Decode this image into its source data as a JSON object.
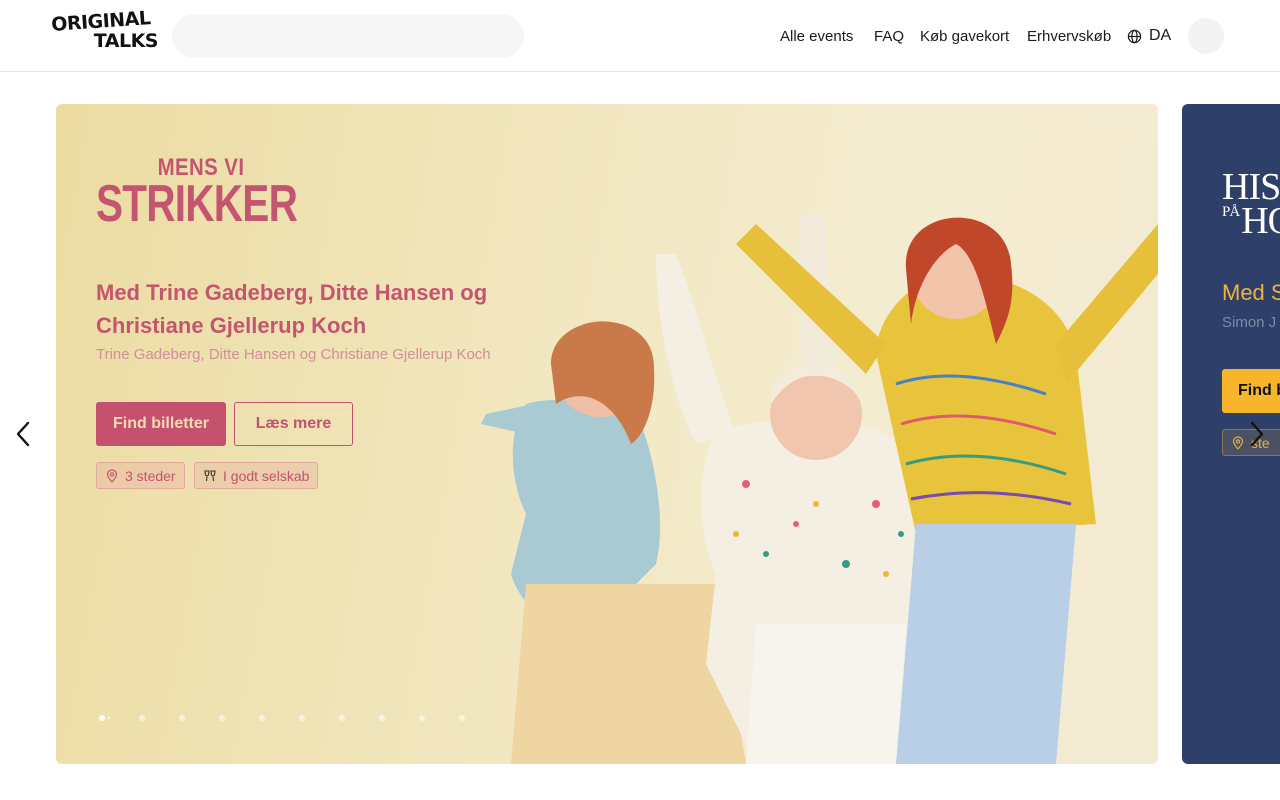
{
  "header": {
    "logo_line1": "ORIGINAL",
    "logo_line2": "TALKS",
    "search_placeholder": "",
    "nav": [
      "Alle events",
      "FAQ",
      "Køb gavekort",
      "Erhvervskøb"
    ],
    "language": "DA"
  },
  "carousel": {
    "active_slide": {
      "show_logo_top": "MENS VI",
      "show_logo_main": "STRIKKER",
      "headline": "Med Trine Gadeberg, Ditte Hansen og Christiane Gjellerup Koch",
      "subline": "Trine Gadeberg, Ditte Hansen og Christiane Gjellerup Koch",
      "primary_button": "Find billetter",
      "secondary_button": "Læs mere",
      "tags": [
        "3 steder",
        "I godt selskab"
      ],
      "accent_color": "#c4526f"
    },
    "next_slide": {
      "logo_small": "PÅ",
      "logo_line1": "HIS",
      "logo_line2": "HO",
      "headline": "Med S",
      "subline": "Simon J",
      "primary_button": "Find b",
      "tag": "ste",
      "background_color": "#2e3f6a",
      "accent_color": "#f7b52c"
    },
    "dots_total": 10,
    "dots_active_index": 0,
    "prev_icon": "chevron-left-icon",
    "next_icon": "chevron-right-icon"
  }
}
